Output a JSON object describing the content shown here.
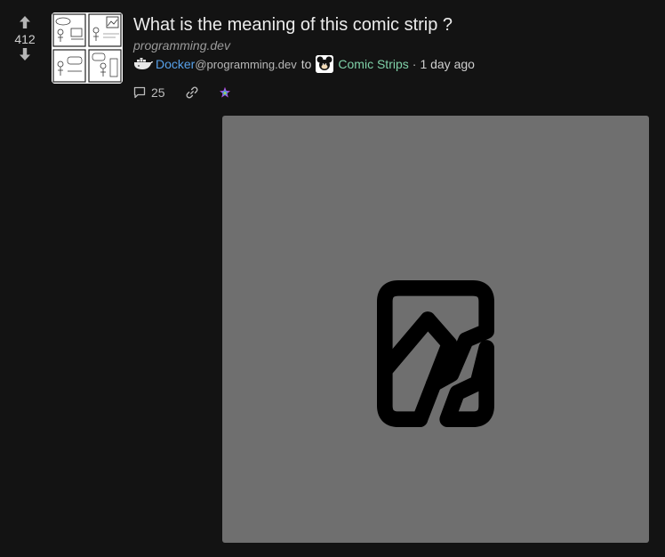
{
  "post": {
    "score": "412",
    "title": "What is the meaning of this comic strip ?",
    "domain": "programming.dev",
    "author": {
      "name": "Docker",
      "instance": "@programming.dev"
    },
    "to_text": "to",
    "community": "Comic Strips",
    "separator": "·",
    "age": "1 day ago",
    "comments_count": "25"
  },
  "icons": {
    "upvote": "arrow-up-icon",
    "downvote": "arrow-down-icon",
    "comments": "comment-bubble-icon",
    "link": "link-chain-icon",
    "crosspost": "rainbow-star-icon",
    "placeholder": "broken-image-icon"
  },
  "colors": {
    "background": "#131313",
    "author": "#57a0e8",
    "community": "#7fd1a8",
    "preview_bg": "#6f6f6f"
  }
}
